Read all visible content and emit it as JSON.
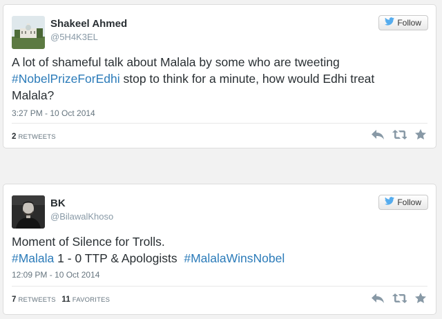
{
  "tweets": [
    {
      "name": "Shakeel Ahmed",
      "handle": "@5H4K3EL",
      "follow_label": "Follow",
      "text_parts": [
        {
          "t": "A lot of shameful talk about Malala by some who are tweeting "
        },
        {
          "t": "#NobelPrizeForEdhi",
          "hashtag": true
        },
        {
          "t": " stop to think for a minute, how would Edhi treat Malala?"
        }
      ],
      "time": "3:27 PM - 10 Oct 2014",
      "retweets_count": "2",
      "retweets_label": "RETWEETS",
      "favorites_count": "",
      "favorites_label": ""
    },
    {
      "name": "BK",
      "handle": "@BilawalKhoso",
      "follow_label": "Follow",
      "text_line1": "Moment of Silence for Trolls.",
      "text_parts": [
        {
          "t": "#Malala",
          "hashtag": true
        },
        {
          "t": " 1 - 0 TTP & Apologists  "
        },
        {
          "t": "#MalalaWinsNobel",
          "hashtag": true
        }
      ],
      "time": "12:09 PM - 10 Oct 2014",
      "retweets_count": "7",
      "retweets_label": "RETWEETS",
      "favorites_count": "11",
      "favorites_label": "FAVORITES"
    }
  ],
  "icons": {
    "follow": "twitter-bird-icon",
    "reply": "reply-icon",
    "retweet": "retweet-icon",
    "favorite": "star-icon"
  },
  "colors": {
    "hashtag": "#2b7bb9",
    "twitter_blue": "#55acee",
    "action_gray": "#8899a6"
  }
}
